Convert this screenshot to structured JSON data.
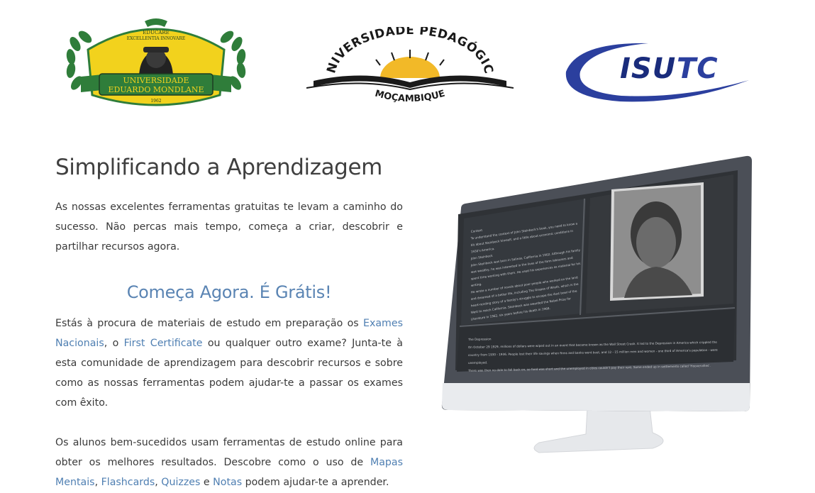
{
  "logos": {
    "uem": {
      "name": "UNIVERSIDADE EDUARDO MONDLANE",
      "motto_top": "EDUCARE",
      "motto_mid": "EXCELLENTIA INNOVARE",
      "year": "1962",
      "colors": {
        "green": "#2f7d3a",
        "yellow": "#f2d21d",
        "dark": "#1d3d22"
      }
    },
    "up": {
      "top_text": "UNIVERSIDADE PEDAGÓGICA",
      "bottom_text": "MOÇAMBIQUE"
    },
    "isutc": {
      "text_isu": "ISU",
      "text_tc": "TC",
      "colors": {
        "navy": "#1a2c7c",
        "blue": "#2b3f9e"
      }
    }
  },
  "main": {
    "title": "Simplificando a Aprendizagem",
    "intro": "As nossas excelentes ferramentas gratuitas te levam a caminho do sucesso. Não percas mais tempo, começa a criar, descobrir e partilhar recursos agora.",
    "cta": "Começa Agora. É Grátis!",
    "para1": {
      "t1": "Estás à procura de materiais de estudo em preparação os ",
      "link1": "Exames Nacionais",
      "t2": ", o ",
      "link2": "First Certificate",
      "t3": " ou qualquer outro exame? Junta-te à esta comunidade de aprendizagem para descobrir recursos e sobre como as nossas ferramentas podem ajudar-te a passar os exames com êxito."
    },
    "para2": {
      "t1": "Os alunos bem-sucedidos usam ferramentas de estudo online para obter os melhores resultados. Descobre como o uso de ",
      "link1": "Mapas Mentais",
      "t2": ", ",
      "link2": "Flashcards",
      "t3": ", ",
      "link3": "Quizzes",
      "t4": " e ",
      "link4": "Notas",
      "t5": " podem ajudar-te a aprender."
    }
  },
  "monitor": {
    "screen_left_heading": "Context",
    "screen_left_lines": [
      "To understand the context of John Steinbeck's book, you need to know a",
      "bit about Steinbeck himself, and a little about economic conditions in",
      "1930's America.",
      "John Steinbeck",
      "John Steinbeck was born in Salinas, California in 1902. Although his family",
      "was wealthy, he was interested in the lives of the farm labourers and",
      "spent time working with them. He used his experiences as material for his",
      "writing.",
      "He wrote a number of novels about poor people who worked on the land",
      "and dreamed of a better life, including The Grapes of Wrath, which is the",
      "heart-rending story of a family's struggle to escape the dust bowl of the",
      "West to reach California. Steinbeck was awarded the Nobel Prize for",
      "Literature in 1962, six years before his death in 1968."
    ],
    "screen_bottom_heading": "The Depression",
    "screen_bottom_lines": [
      "On October 29 1929, millions of dollars were wiped out in an event that became known as the Wall Street Crash. It led to the Depression in America which crippled the",
      "country from 1930 - 1936. People lost their life savings when firms and banks went bust, and 12 - 15 million men and women - one third of America's population - were",
      "unemployed.",
      "There was then no dole to fall back on, so food was short and the unemployed in cities couldn't pay their rent. Some ended up in settlements called 'Hoovervilles'."
    ]
  }
}
